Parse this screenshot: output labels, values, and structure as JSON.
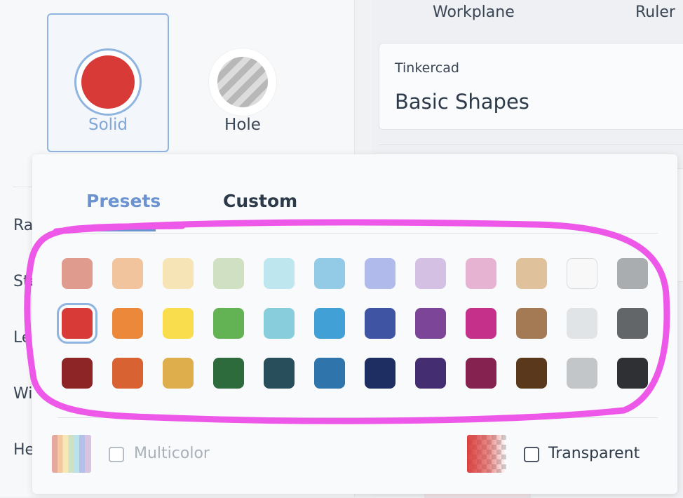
{
  "shape_types": [
    {
      "label": "Solid",
      "selected": true
    },
    {
      "label": "Hole",
      "selected": false
    }
  ],
  "left_rows": [
    "Radius",
    "Steps",
    "Length",
    "Width",
    "Height"
  ],
  "right_panel": {
    "tools": [
      "Workplane",
      "Ruler"
    ],
    "library": {
      "brand": "Tinkercad",
      "name": "Basic Shapes"
    }
  },
  "popup": {
    "tabs": [
      "Presets",
      "Custom"
    ],
    "active_tab": "Presets",
    "colors": [
      [
        "#df9b8e",
        "#f2c49e",
        "#f7e4b6",
        "#cfe1c2",
        "#bde6ee",
        "#93cbe6",
        "#b0bbec",
        "#d4c0e2",
        "#e6b4d2",
        "#dfc19b",
        "#f8f8f8",
        "#a9adb0"
      ],
      [
        "#d83a38",
        "#eb883a",
        "#f9dd4c",
        "#63b354",
        "#88cddb",
        "#41a1d6",
        "#3f55a3",
        "#7c4597",
        "#c5308b",
        "#a47a55",
        "#e1e4e6",
        "#626668"
      ],
      [
        "#8d2426",
        "#d96233",
        "#ddae4b",
        "#2d6b3d",
        "#274e5a",
        "#2f74ab",
        "#1e2d62",
        "#442d70",
        "#86224f",
        "#5a381c",
        "#c2c6c8",
        "#2e3034"
      ]
    ],
    "selected_color": "#d83a38",
    "multicolor_label": "Multicolor",
    "transparent_label": "Transparent"
  },
  "annotation_color": "#ee58e8"
}
